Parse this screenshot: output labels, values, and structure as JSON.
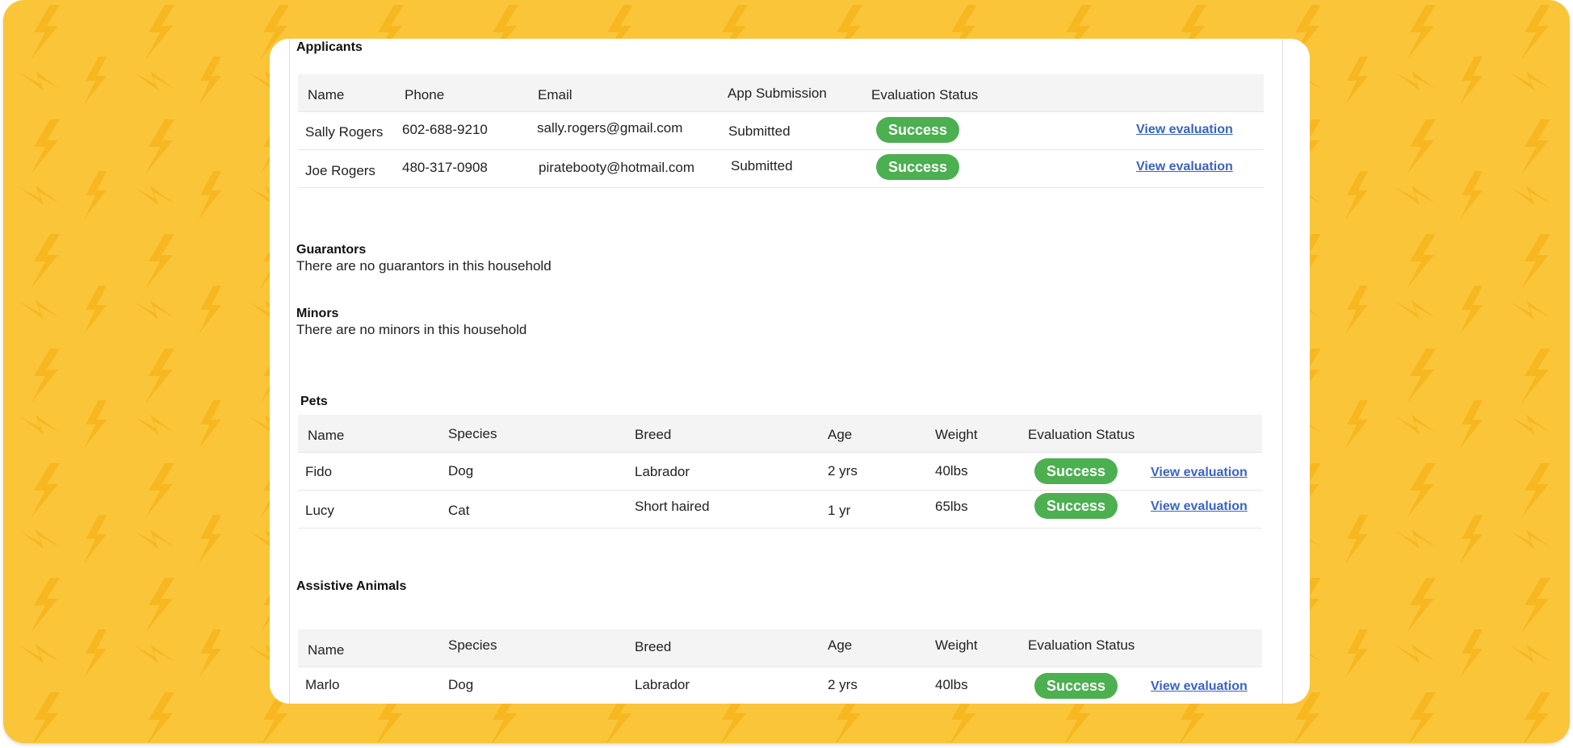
{
  "colors": {
    "background": "#fbc53a",
    "bolt": "#f7b720",
    "success": "#4caf50",
    "link": "#3a63c2"
  },
  "applicants": {
    "title": "Applicants",
    "columns": [
      "Name",
      "Phone",
      "Email",
      "App Submission",
      "Evaluation Status"
    ],
    "rows": [
      {
        "name": "Sally Rogers",
        "phone": "602-688-9210",
        "email": "sally.rogers@gmail.com",
        "submission": "Submitted",
        "status": "Success",
        "link": "View evaluation"
      },
      {
        "name": "Joe Rogers",
        "phone": "480-317-0908",
        "email": "piratebooty@hotmail.com",
        "submission": "Submitted",
        "status": "Success",
        "link": "View evaluation"
      }
    ]
  },
  "guarantors": {
    "title": "Guarantors",
    "note": "There are no guarantors in this household"
  },
  "minors": {
    "title": "Minors",
    "note": "There are no minors in this household"
  },
  "pets": {
    "title": "Pets",
    "columns": [
      "Name",
      "Species",
      "Breed",
      "Age",
      "Weight",
      "Evaluation Status"
    ],
    "rows": [
      {
        "name": "Fido",
        "species": "Dog",
        "breed": "Labrador",
        "age": "2 yrs",
        "weight": "40lbs",
        "status": "Success",
        "link": "View evaluation"
      },
      {
        "name": "Lucy",
        "species": "Cat",
        "breed": "Short haired",
        "age": "1 yr",
        "weight": "65lbs",
        "status": "Success",
        "link": "View evaluation"
      }
    ]
  },
  "assistive_animals": {
    "title": "Assistive Animals",
    "columns": [
      "Name",
      "Species",
      "Breed",
      "Age",
      "Weight",
      "Evaluation Status"
    ],
    "rows": [
      {
        "name": "Marlo",
        "species": "Dog",
        "breed": "Labrador",
        "age": "2 yrs",
        "weight": "40lbs",
        "status": "Success",
        "link": "View evaluation"
      }
    ]
  }
}
